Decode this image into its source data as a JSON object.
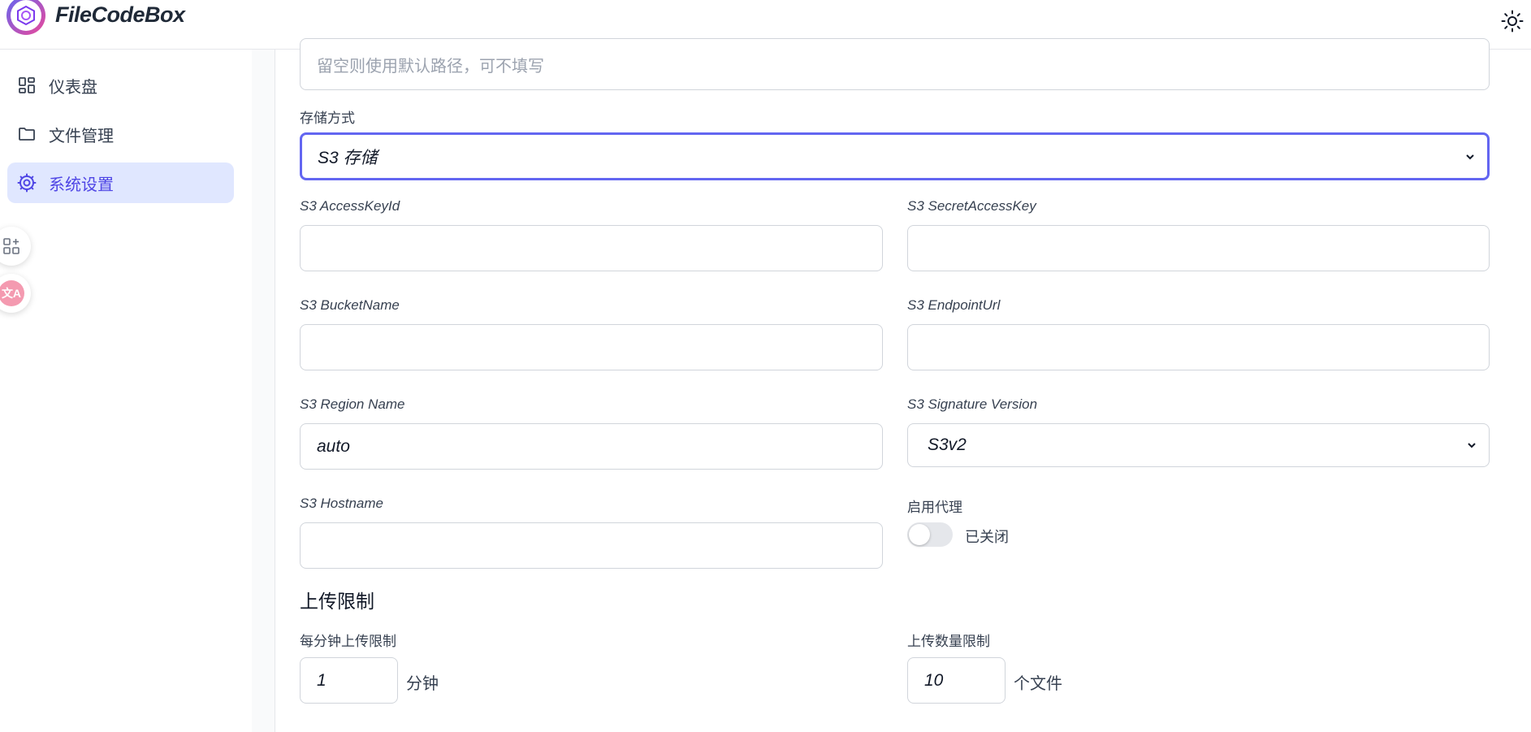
{
  "app": {
    "name": "FileCodeBox"
  },
  "sidebar": {
    "items": [
      {
        "label": "仪表盘",
        "icon": "dashboard-icon"
      },
      {
        "label": "文件管理",
        "icon": "folder-icon"
      },
      {
        "label": "系统设置",
        "icon": "gear-icon",
        "active": true
      }
    ],
    "floating_buttons": [
      {
        "icon": "add-apps-icon"
      },
      {
        "icon": "translate-icon"
      }
    ]
  },
  "form": {
    "storage_path": {
      "placeholder": "留空则使用默认路径，可不填写",
      "value": ""
    },
    "storage_method": {
      "label": "存储方式",
      "selected": "S3 存储"
    },
    "s3_access_key_id": {
      "label": "S3 AccessKeyId",
      "value": ""
    },
    "s3_secret_access_key": {
      "label": "S3 SecretAccessKey",
      "value": ""
    },
    "s3_bucket_name": {
      "label": "S3 BucketName",
      "value": ""
    },
    "s3_endpoint_url": {
      "label": "S3 EndpointUrl",
      "value": ""
    },
    "s3_region_name": {
      "label": "S3 Region Name",
      "value": "auto"
    },
    "s3_signature_version": {
      "label": "S3 Signature Version",
      "selected": "S3v2"
    },
    "s3_hostname": {
      "label": "S3 Hostname",
      "value": ""
    },
    "proxy": {
      "label": "启用代理",
      "state_text": "已关闭",
      "enabled": false
    }
  },
  "upload_limits": {
    "title": "上传限制",
    "per_minute": {
      "label": "每分钟上传限制",
      "value": "1",
      "unit": "分钟"
    },
    "count": {
      "label": "上传数量限制",
      "value": "10",
      "unit": "个文件"
    }
  },
  "colors": {
    "accent": "#6366f1",
    "active_bg": "#e0e7ff",
    "brand_gradient_start": "#6366f1",
    "brand_gradient_end": "#ec4899"
  }
}
